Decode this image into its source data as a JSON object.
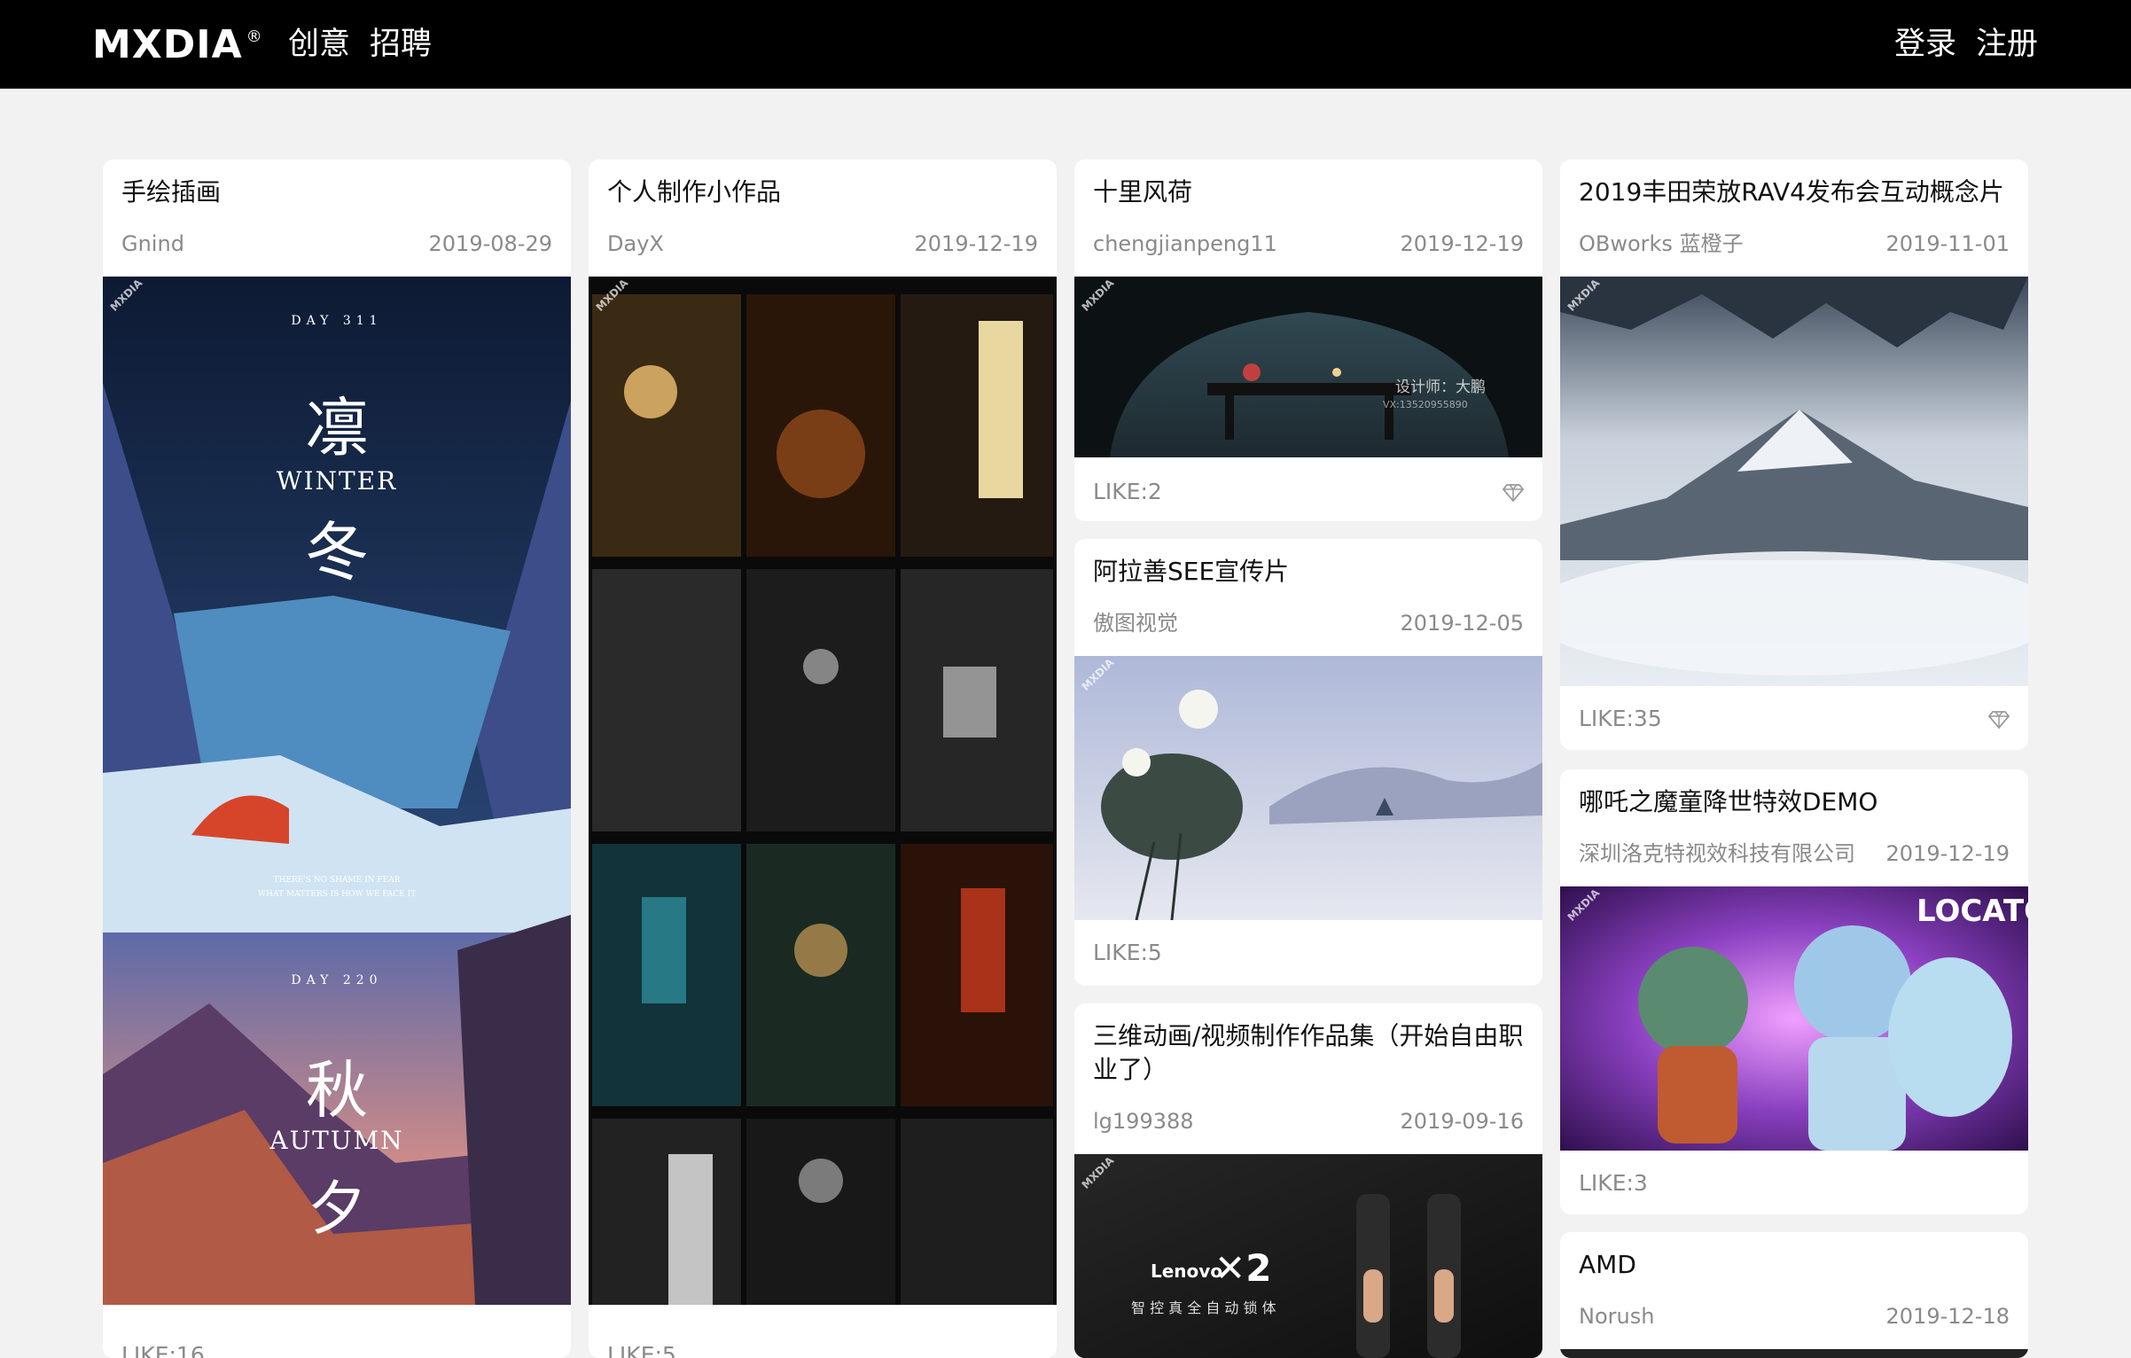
{
  "header": {
    "logo": "MXDIA",
    "registered_mark": "®",
    "nav": [
      "创意",
      "招聘"
    ],
    "auth": [
      "登录",
      "注册"
    ]
  },
  "watermark": "MXDIA",
  "cards": [
    {
      "title": "手绘插画",
      "author": "Gnind",
      "date": "2019-08-29",
      "like": "LIKE:16",
      "overlay": {
        "day1": "DAY 311",
        "char1": "凛",
        "season1": "WINTER",
        "char2": "冬",
        "caption1": "THERE'S NO SHAME IN FEAR",
        "caption2": "WHAT MATTERS IS HOW WE FACE IT",
        "day2": "DAY 220",
        "char3": "秋",
        "season2": "AUTUMN",
        "char4": "夕"
      }
    },
    {
      "title": "个人制作小作品",
      "author": "DayX",
      "date": "2019-12-19",
      "like": "LIKE:5"
    },
    {
      "title": "十里风荷",
      "author": "chengjianpeng11",
      "date": "2019-12-19",
      "like": "LIKE:2",
      "overlay_text": "设计师：大鹏",
      "overlay_sub": "VX:13520955890"
    },
    {
      "title": "阿拉善SEE宣传片",
      "author": "傲图视觉",
      "date": "2019-12-05",
      "like": "LIKE:5"
    },
    {
      "title": "三维动画/视频制作作品集（开始自由职业了）",
      "author": "lg199388",
      "date": "2019-09-16",
      "overlay": {
        "brand": "Lenovo",
        "model": "2",
        "tagline": "智 控 真 全 自 动 锁 体"
      }
    },
    {
      "title": "2019丰田荣放RAV4发布会互动概念片",
      "author": "OBworks 蓝橙子",
      "date": "2019-11-01",
      "like": "LIKE:35"
    },
    {
      "title": "哪吒之魔童降世特效DEMO",
      "author": "深圳洛克特视效科技有限公司",
      "date": "2019-12-19",
      "like": "LIKE:3",
      "overlay_text": "LOCATO"
    },
    {
      "title": "AMD",
      "author": "Norush",
      "date": "2019-12-18"
    }
  ],
  "colors": {
    "header_bg": "#000000",
    "page_bg": "#f2f2f2",
    "card_bg": "#ffffff",
    "meta_text": "#8a8a8a"
  }
}
